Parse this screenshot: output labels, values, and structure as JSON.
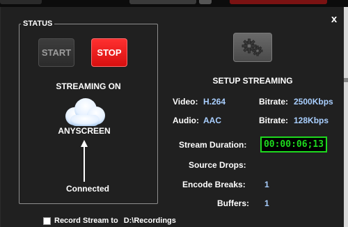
{
  "window": {
    "close_glyph": "x"
  },
  "status": {
    "legend": "STATUS",
    "start_label": "START",
    "stop_label": "STOP",
    "streaming_state": "STREAMING ON",
    "destination": "ANYSCREEN",
    "connection": "Connected"
  },
  "setup": {
    "label": "SETUP STREAMING"
  },
  "stats": {
    "video_key": "Video:",
    "video_val": "H.264",
    "bitrate_key_1": "Bitrate:",
    "video_bitrate": "2500Kbps",
    "audio_key": "Audio:",
    "audio_val": "AAC",
    "bitrate_key_2": "Bitrate:",
    "audio_bitrate": "128Kbps",
    "duration_key": "Stream Duration:",
    "duration_val": "00:00:06;13",
    "source_drops_key": "Source Drops:",
    "encode_breaks_key": "Encode Breaks:",
    "encode_breaks_val": "1",
    "buffers_key": "Buffers:",
    "buffers_val": "1"
  },
  "record": {
    "label": "Record Stream to",
    "path": "D:\\Recordings",
    "checked": false
  },
  "colors": {
    "stop_red": "#e81818",
    "value_blue": "#a9cfff",
    "timer_green": "#1ed91e"
  },
  "icons": {
    "cloud": "cloud-icon",
    "arrow": "up-arrow-icon",
    "gear": "gears-icon",
    "close": "close-icon"
  }
}
